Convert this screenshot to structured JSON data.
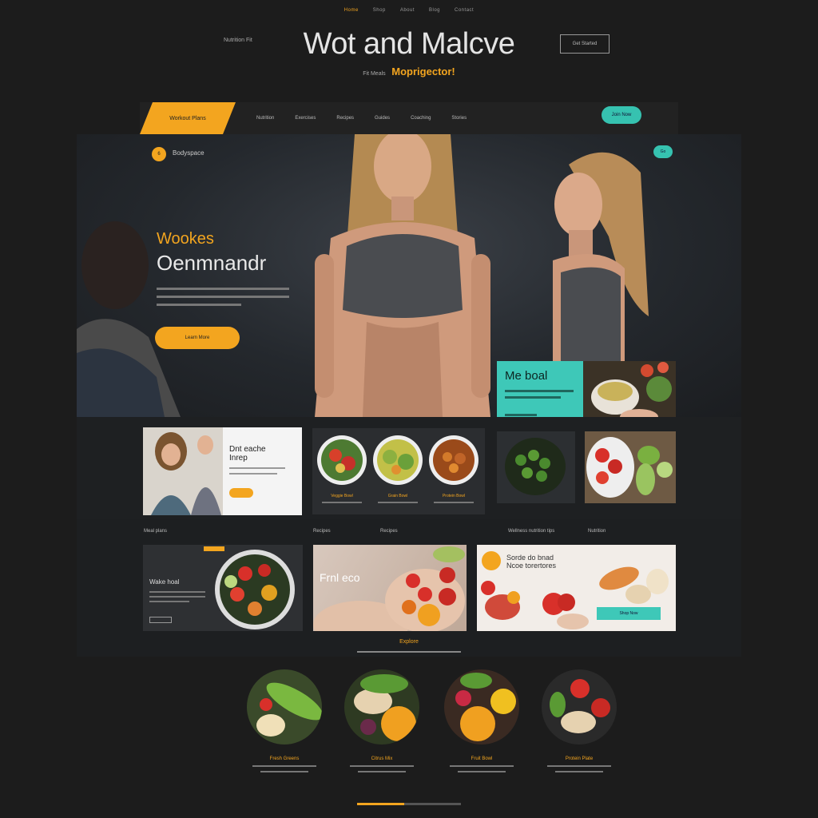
{
  "topnav": {
    "items": [
      "Home",
      "Shop",
      "About",
      "Blog",
      "Contact"
    ]
  },
  "header": {
    "brand_small": "Nutrition Fit",
    "title": "Wot and Malcve",
    "cta": "Get Started",
    "subtitle_pre": "Fit Meals",
    "subtitle_highlight": "Moprigector!"
  },
  "mainnav": {
    "active": "Workout Plans",
    "items": [
      "Nutrition",
      "Exercises",
      "Recipes",
      "Guides",
      "Coaching",
      "Stories"
    ],
    "pill": "Join Now"
  },
  "hero": {
    "badge_label": "Bodyspace",
    "kicker": "Wookes",
    "heading": "Oenmnandr",
    "button": "Learn More",
    "pill": "Go"
  },
  "teal_card": {
    "title": "Me boal"
  },
  "card_white": {
    "title_line1": "Dnt eache",
    "title_line2": "Inrep"
  },
  "bowls": [
    "Veggie Bowl",
    "Grain Bowl",
    "Protein Bowl"
  ],
  "row3": {
    "labels": [
      "Meal plans",
      "Recipes",
      "Wellness nutrition tips",
      "Nutrition"
    ],
    "card_a_title": "Wake hoal",
    "card_b_title": "Frnl eco",
    "card_c_title_line1": "Sorde do bnad",
    "card_c_title_line2": "Ncoe torertores",
    "card_c_button": "Shop Now"
  },
  "section": {
    "label": "Explore"
  },
  "circle_items": [
    {
      "caption": "Fresh Greens"
    },
    {
      "caption": "Citrus Mix"
    },
    {
      "caption": "Fruit Bowl"
    },
    {
      "caption": "Protein Plate"
    }
  ],
  "colors": {
    "accent": "#f3a51f",
    "teal": "#3ec8b8",
    "bg": "#1c1c1c"
  }
}
